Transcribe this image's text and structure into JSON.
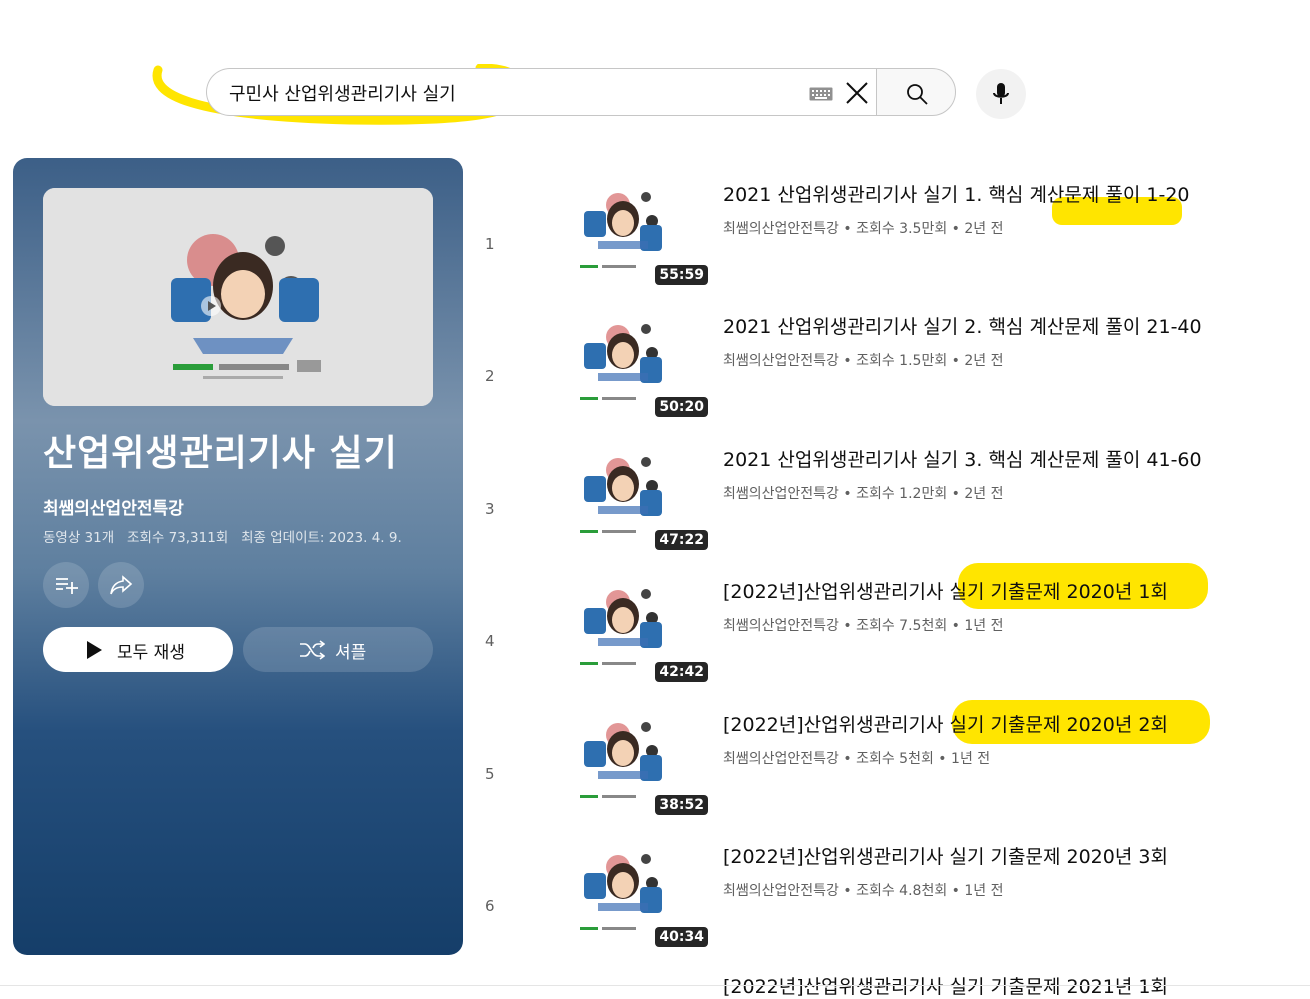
{
  "search": {
    "query": "구민사 산업위생관리기사 실기"
  },
  "playlist": {
    "title": "산업위생관리기사 실기",
    "channel": "최쌤의산업안전특강",
    "video_count": "동영상 31개",
    "views": "조회수 73,311회",
    "updated": "최종 업데이트: 2023. 4. 9.",
    "play_all_label": "모두 재생",
    "shuffle_label": "셔플"
  },
  "videos": [
    {
      "index": "1",
      "title": "2021 산업위생관리기사 실기 1. 핵심 계산문제 풀이 1-20",
      "channel": "최쌤의산업안전특강",
      "views": "조회수 3.5만회",
      "age": "2년 전",
      "duration": "55:59"
    },
    {
      "index": "2",
      "title": "2021 산업위생관리기사 실기 2. 핵심 계산문제 풀이 21-40",
      "channel": "최쌤의산업안전특강",
      "views": "조회수 1.5만회",
      "age": "2년 전",
      "duration": "50:20"
    },
    {
      "index": "3",
      "title": "2021 산업위생관리기사 실기 3. 핵심 계산문제 풀이 41-60",
      "channel": "최쌤의산업안전특강",
      "views": "조회수 1.2만회",
      "age": "2년 전",
      "duration": "47:22"
    },
    {
      "index": "4",
      "title": "[2022년]산업위생관리기사 실기 기출문제 2020년 1회",
      "channel": "최쌤의산업안전특강",
      "views": "조회수 7.5천회",
      "age": "1년 전",
      "duration": "42:42"
    },
    {
      "index": "5",
      "title": "[2022년]산업위생관리기사 실기 기출문제 2020년 2회",
      "channel": "최쌤의산업안전특강",
      "views": "조회수 5천회",
      "age": "1년 전",
      "duration": "38:52"
    },
    {
      "index": "6",
      "title": "[2022년]산업위생관리기사 실기 기출문제 2020년 3회",
      "channel": "최쌤의산업안전특강",
      "views": "조회수 4.8천회",
      "age": "1년 전",
      "duration": "40:34"
    }
  ],
  "partial_next_title": "[2022년]산업위생관리기사 실기 기출문제 2021년 1회",
  "colors": {
    "highlight": "#ffe500",
    "panel_top": "#3c5f87",
    "panel_bottom": "#153e69"
  }
}
